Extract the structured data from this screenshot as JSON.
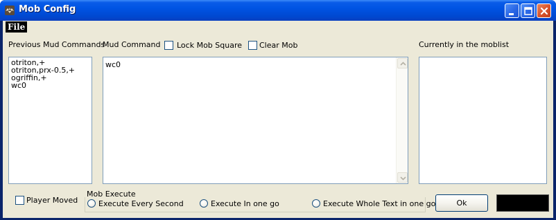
{
  "window": {
    "title": "Mob Config",
    "icons": {
      "app": "bat-app-icon",
      "minimize": "minimize-icon",
      "maximize": "maximize-icon",
      "close": "close-icon"
    }
  },
  "menu": {
    "file_label": "File"
  },
  "previous_commands": {
    "label": "Previous Mud Commands",
    "items": [
      "otriton,+",
      "otriton,prx-0.5,+",
      "ogriffin,+",
      "wc0"
    ]
  },
  "mud_command": {
    "label": "Mud Command",
    "value": "wc0",
    "scroll_icons": {
      "up": "scroll-up-icon",
      "down": "scroll-down-icon"
    }
  },
  "checkboxes": {
    "lock_mob_square": {
      "label": "Lock Mob Square",
      "checked": false
    },
    "clear_mob": {
      "label": "Clear Mob",
      "checked": false
    },
    "player_moved": {
      "label": "Player Moved",
      "checked": false
    }
  },
  "moblist": {
    "label": "Currently in the moblist",
    "items": []
  },
  "mob_execute": {
    "label": "Mob Execute",
    "options": [
      "Execute Every Second",
      "Execute In one go",
      "Execute Whole Text in one go"
    ],
    "selected": null
  },
  "buttons": {
    "ok_label": "Ok"
  },
  "colors": {
    "titlebar": "#0054e3",
    "client_bg": "#ece9d8",
    "input_border": "#7f9db9",
    "color_swatch": "#000000"
  }
}
